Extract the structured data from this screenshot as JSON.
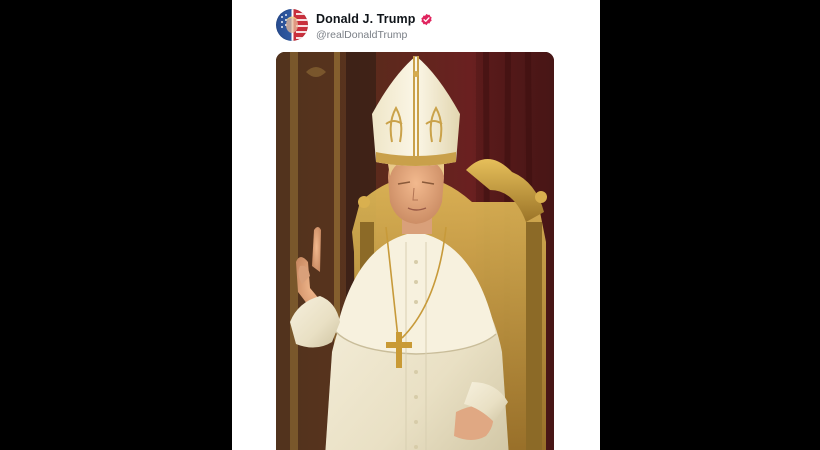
{
  "post": {
    "author": {
      "display_name": "Donald J. Trump",
      "handle": "@realDonaldTrump",
      "verified": true,
      "verified_badge_color": "#e0245e",
      "avatar_icon": "flag-portrait-avatar"
    },
    "media": {
      "type": "image",
      "icon": "papal-portrait-image"
    }
  },
  "colors": {
    "backdrop": "#000000",
    "card": "#ffffff",
    "name_text": "#0f1419",
    "handle_text": "#7a7f86"
  }
}
